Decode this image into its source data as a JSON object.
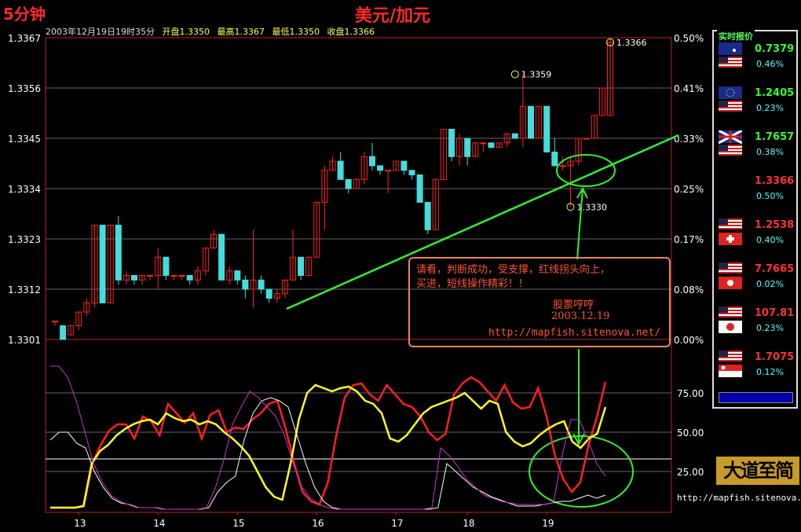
{
  "header": {
    "period": "5分钟",
    "title": "美元/加元",
    "date": "2003年12月19日19时35分",
    "open": "开盘1.3350",
    "high": "最高1.3367",
    "low": "最低1.3350",
    "close": "收盘1.3366"
  },
  "chart_data": [
    {
      "type": "candlestick",
      "title": "美元/加元",
      "y_ticks": [
        "1.3367",
        "1.3356",
        "1.3345",
        "1.3334",
        "1.3323",
        "1.3312",
        "1.3301"
      ],
      "y_pct_ticks": [
        "0.50%",
        "0.41%",
        "0.33%",
        "0.25%",
        "0.17%",
        "0.08%",
        "0.00%"
      ],
      "ylim": [
        1.3301,
        1.3367
      ],
      "x_ticks": [
        "13",
        "14",
        "15",
        "16",
        "17",
        "18",
        "19"
      ],
      "x_tick_index": [
        3,
        13,
        23,
        33,
        43,
        52,
        62
      ],
      "annotations": [
        {
          "label": "1.3359",
          "index": 58,
          "value": 1.3359
        },
        {
          "label": "1.3366",
          "index": 70,
          "value": 1.3366
        },
        {
          "label": "1.3330",
          "index": 65,
          "value": 1.333
        }
      ],
      "candles": [
        [
          1.3305,
          1.3305,
          1.3304,
          1.3305
        ],
        [
          1.3304,
          1.3304,
          1.3301,
          1.3301
        ],
        [
          1.3302,
          1.3304,
          1.3302,
          1.3304
        ],
        [
          1.3304,
          1.3307,
          1.3303,
          1.3307
        ],
        [
          1.3307,
          1.331,
          1.3306,
          1.3309
        ],
        [
          1.3309,
          1.3326,
          1.3308,
          1.3326
        ],
        [
          1.3326,
          1.3326,
          1.3309,
          1.3309
        ],
        [
          1.3309,
          1.3326,
          1.3309,
          1.3326
        ],
        [
          1.3326,
          1.3328,
          1.3313,
          1.3314
        ],
        [
          1.3314,
          1.3316,
          1.3313,
          1.3315
        ],
        [
          1.3315,
          1.3315,
          1.3313,
          1.3314
        ],
        [
          1.3314,
          1.3315,
          1.3313,
          1.3315
        ],
        [
          1.3315,
          1.3315,
          1.3314,
          1.3315
        ],
        [
          1.3315,
          1.3321,
          1.3312,
          1.3319
        ],
        [
          1.3319,
          1.3319,
          1.3314,
          1.3315
        ],
        [
          1.3315,
          1.3315,
          1.3314,
          1.3315
        ],
        [
          1.3315,
          1.3315,
          1.3314,
          1.3315
        ],
        [
          1.3315,
          1.3315,
          1.3313,
          1.3314
        ],
        [
          1.3314,
          1.3317,
          1.3313,
          1.3316
        ],
        [
          1.3316,
          1.3321,
          1.3315,
          1.3321
        ],
        [
          1.3321,
          1.3325,
          1.3321,
          1.3324
        ],
        [
          1.3324,
          1.3324,
          1.3314,
          1.3314
        ],
        [
          1.3314,
          1.3317,
          1.3313,
          1.3316
        ],
        [
          1.3316,
          1.3316,
          1.3313,
          1.3314
        ],
        [
          1.3314,
          1.3315,
          1.331,
          1.3312
        ],
        [
          1.3312,
          1.3325,
          1.3308,
          1.3314
        ],
        [
          1.3314,
          1.3315,
          1.3311,
          1.3312
        ],
        [
          1.3312,
          1.3312,
          1.3309,
          1.331
        ],
        [
          1.331,
          1.3312,
          1.3309,
          1.3311
        ],
        [
          1.3311,
          1.3314,
          1.331,
          1.3314
        ],
        [
          1.3314,
          1.3325,
          1.3314,
          1.3319
        ],
        [
          1.3319,
          1.3319,
          1.3314,
          1.3315
        ],
        [
          1.3315,
          1.3319,
          1.3315,
          1.3319
        ],
        [
          1.3319,
          1.3331,
          1.3319,
          1.3331
        ],
        [
          1.3331,
          1.3339,
          1.3325,
          1.3338
        ],
        [
          1.3338,
          1.3341,
          1.3338,
          1.334
        ],
        [
          1.334,
          1.3342,
          1.3336,
          1.3336
        ],
        [
          1.3336,
          1.3336,
          1.3333,
          1.3334
        ],
        [
          1.3334,
          1.3336,
          1.3334,
          1.3336
        ],
        [
          1.3336,
          1.3342,
          1.3335,
          1.3341
        ],
        [
          1.3341,
          1.3344,
          1.3338,
          1.3339
        ],
        [
          1.3339,
          1.3339,
          1.3337,
          1.3338
        ],
        [
          1.3338,
          1.3338,
          1.3333,
          1.3338
        ],
        [
          1.3338,
          1.334,
          1.3338,
          1.334
        ],
        [
          1.334,
          1.334,
          1.3337,
          1.3338
        ],
        [
          1.3338,
          1.3338,
          1.3336,
          1.3337
        ],
        [
          1.3337,
          1.3337,
          1.3331,
          1.3331
        ],
        [
          1.3331,
          1.3331,
          1.3324,
          1.3325
        ],
        [
          1.3325,
          1.3336,
          1.3325,
          1.3336
        ],
        [
          1.3336,
          1.3347,
          1.3336,
          1.3347
        ],
        [
          1.3347,
          1.3347,
          1.334,
          1.3341
        ],
        [
          1.3341,
          1.3346,
          1.3339,
          1.3345
        ],
        [
          1.3345,
          1.3345,
          1.3339,
          1.3341
        ],
        [
          1.3341,
          1.3344,
          1.3341,
          1.3344
        ],
        [
          1.3344,
          1.3344,
          1.3342,
          1.3344
        ],
        [
          1.3344,
          1.3344,
          1.3343,
          1.3343
        ],
        [
          1.3343,
          1.3344,
          1.3343,
          1.3344
        ],
        [
          1.3344,
          1.3346,
          1.3343,
          1.3346
        ],
        [
          1.3346,
          1.3346,
          1.3345,
          1.3345
        ],
        [
          1.3345,
          1.3359,
          1.3343,
          1.3352
        ],
        [
          1.3352,
          1.3352,
          1.3345,
          1.3345
        ],
        [
          1.3345,
          1.3352,
          1.3345,
          1.3352
        ],
        [
          1.3352,
          1.3352,
          1.3342,
          1.3342
        ],
        [
          1.3342,
          1.3345,
          1.3339,
          1.3339
        ],
        [
          1.3339,
          1.3341,
          1.3338,
          1.3339
        ],
        [
          1.3339,
          1.3341,
          1.333,
          1.334
        ],
        [
          1.334,
          1.3345,
          1.3339,
          1.3345
        ],
        [
          1.3345,
          1.3345,
          1.3345,
          1.3345
        ],
        [
          1.3345,
          1.335,
          1.3345,
          1.335
        ],
        [
          1.335,
          1.3356,
          1.335,
          1.3356
        ],
        [
          1.335,
          1.3367,
          1.335,
          1.3366
        ]
      ]
    },
    {
      "type": "line",
      "y_ticks": [
        "75.00",
        "50.00",
        "25.00"
      ],
      "ylim": [
        0,
        100
      ],
      "series": [
        {
          "color": "#ff2020",
          "values": [
            2,
            2,
            2,
            2,
            3,
            30,
            42,
            51,
            55,
            55,
            46,
            60,
            57,
            48,
            68,
            62,
            56,
            62,
            46,
            61,
            64,
            50,
            53,
            52,
            58,
            62,
            68,
            70,
            52,
            30,
            12,
            6,
            4,
            18,
            48,
            72,
            80,
            81,
            74,
            70,
            80,
            74,
            68,
            66,
            60,
            50,
            45,
            49,
            74,
            81,
            85,
            82,
            76,
            70,
            80,
            69,
            65,
            66,
            78,
            60,
            35,
            20,
            12,
            18,
            42,
            60,
            82
          ]
        },
        {
          "color": "#ffff20",
          "values": [
            2,
            2,
            2,
            2,
            3,
            30,
            38,
            42,
            48,
            52,
            55,
            57,
            58,
            55,
            62,
            59,
            57,
            58,
            55,
            57,
            55,
            50,
            46,
            41,
            35,
            25,
            15,
            9,
            7,
            30,
            58,
            75,
            80,
            78,
            76,
            78,
            79,
            76,
            70,
            68,
            62,
            46,
            44,
            48,
            55,
            62,
            66,
            68,
            70,
            72,
            75,
            70,
            65,
            70,
            68,
            50,
            44,
            41,
            43,
            48,
            52,
            55,
            57,
            44,
            40,
            46,
            49,
            66
          ]
        },
        {
          "color": "#ffffff",
          "values": [
            45,
            50,
            50,
            43,
            40,
            25,
            15,
            8,
            5,
            4,
            2,
            2,
            2,
            1,
            1,
            1,
            1,
            1,
            2,
            12,
            18,
            22,
            45,
            62,
            70,
            72,
            70,
            66,
            48,
            30,
            15,
            6,
            2,
            1,
            1,
            1,
            1,
            1,
            1,
            1,
            1,
            1,
            1,
            1,
            2,
            30,
            25,
            20,
            15,
            12,
            9,
            7,
            5,
            3,
            3,
            3,
            4,
            5,
            6,
            6,
            8,
            10,
            8,
            10
          ]
        },
        {
          "color": "#cc33cc",
          "values": [
            92,
            92,
            85,
            70,
            50,
            30,
            18,
            10,
            6,
            4,
            2,
            2,
            2,
            1,
            1,
            1,
            1,
            1,
            2,
            14,
            32,
            55,
            66,
            76,
            72,
            66,
            60,
            48,
            30,
            15,
            8,
            4,
            2,
            1,
            1,
            1,
            1,
            1,
            1,
            1,
            1,
            1,
            1,
            1,
            2,
            40,
            35,
            28,
            20,
            15,
            10,
            8,
            6,
            5,
            4,
            4,
            4,
            4,
            5,
            35,
            58,
            58,
            45,
            30,
            22
          ]
        }
      ]
    }
  ],
  "note": {
    "line1": "请看，判断成功，受支撑，红线拐头向上，",
    "line2": "买进，短线操作精彩！！",
    "author": "股票哼哼",
    "date": "2003.12.19",
    "url": "http://mapfish.sitenova.net/"
  },
  "quotes_panel": {
    "title": "实时报价",
    "items": [
      {
        "value": "0.7379",
        "pct": "0.46%",
        "value_color": "#33ff33",
        "flag": "australia-us"
      },
      {
        "value": "1.2405",
        "pct": "0.23%",
        "value_color": "#33ff33",
        "flag": "eu-us"
      },
      {
        "value": "1.7657",
        "pct": "0.38%",
        "value_color": "#33ff33",
        "flag": "uk-us"
      },
      {
        "value": "1.3366",
        "pct": "0.50%",
        "value_color": "#ff3333",
        "flag": "none"
      },
      {
        "value": "1.2538",
        "pct": "0.40%",
        "value_color": "#ff3333",
        "flag": "us-switzerland"
      },
      {
        "value": "7.7665",
        "pct": "0.02%",
        "value_color": "#ff3333",
        "flag": "us-hongkong"
      },
      {
        "value": "107.81",
        "pct": "0.23%",
        "value_color": "#ff3333",
        "flag": "us-japan"
      },
      {
        "value": "1.7075",
        "pct": "0.12%",
        "value_color": "#ff3333",
        "flag": "us-singapore"
      }
    ]
  },
  "logo": "大道至简",
  "website": "http://mapfish.sitenova.net/"
}
